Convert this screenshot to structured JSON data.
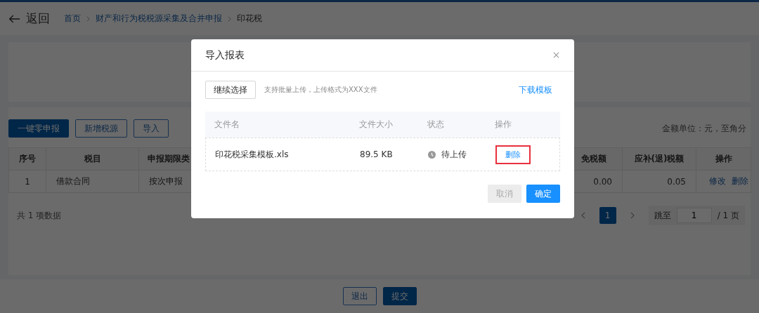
{
  "header": {
    "back_label": "返回",
    "breadcrumb": [
      {
        "label": "首页",
        "current": false
      },
      {
        "label": "财产和行为税税源采集及合并申报",
        "current": false
      },
      {
        "label": "印花税",
        "current": true
      }
    ]
  },
  "toolbar": {
    "buttons": [
      {
        "label": "一键零申报",
        "kind": "primary"
      },
      {
        "label": "新增税源",
        "kind": "outline"
      },
      {
        "label": "导入",
        "kind": "outline"
      }
    ],
    "unit_note": "金额单位：元，至角分"
  },
  "table": {
    "headers": [
      "序号",
      "税目",
      "申报期限类",
      "免税额",
      "应补(退)税额",
      "操作"
    ],
    "rows": [
      {
        "cells": [
          "1",
          "借款合同",
          "按次申报",
          "0.00",
          "0.05"
        ],
        "actions": [
          "修改",
          "删除"
        ]
      }
    ]
  },
  "pagination": {
    "total": "共 1 项数据",
    "pages": [
      {
        "label": "1",
        "selected": true
      }
    ],
    "jump_label": "跳至",
    "jump_value": "1",
    "page_total": "/ 1 页"
  },
  "footer": {
    "buttons": [
      {
        "label": "退出",
        "kind": "outline"
      },
      {
        "label": "提交",
        "kind": "primary"
      }
    ]
  },
  "modal": {
    "title": "导入报表",
    "choose_button": "继续选择",
    "hint": "支持批量上传，上传格式为XXX文件",
    "download_link": "下载模板",
    "columns": [
      "文件名",
      "文件大小",
      "状态",
      "操作"
    ],
    "files": [
      {
        "name": "印花税采集模板.xls",
        "size": "89.5 KB",
        "status": "待上传",
        "action": "删除",
        "highlighted": true
      }
    ],
    "buttons": [
      {
        "label": "取消",
        "kind": "default",
        "disabled": true
      },
      {
        "label": "确定",
        "kind": "primary",
        "disabled": false
      }
    ]
  }
}
